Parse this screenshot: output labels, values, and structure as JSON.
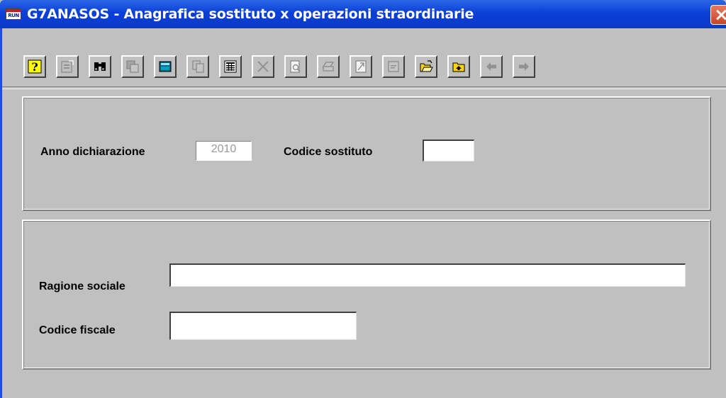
{
  "window": {
    "title": "G7ANASOS - Anagrafica sostituto x operazioni straordinarie",
    "icon_text": "RUN"
  },
  "toolbar": {
    "buttons": [
      {
        "name": "help-button",
        "icon": "question-icon"
      },
      {
        "name": "properties-button",
        "icon": "properties-icon"
      },
      {
        "name": "search-button",
        "icon": "binoculars-icon"
      },
      {
        "name": "copy-record-button",
        "icon": "copy-record-icon"
      },
      {
        "name": "calculator-button",
        "icon": "calculator-icon"
      },
      {
        "name": "paste-button",
        "icon": "paste-icon"
      },
      {
        "name": "list-button",
        "icon": "list-view-icon"
      },
      {
        "name": "delete-button",
        "icon": "delete-x-icon"
      },
      {
        "name": "preview-button",
        "icon": "print-preview-icon"
      },
      {
        "name": "print-button",
        "icon": "printer-icon"
      },
      {
        "name": "export-button",
        "icon": "document-export-icon"
      },
      {
        "name": "note-button",
        "icon": "note-icon"
      },
      {
        "name": "open-folder-button",
        "icon": "open-folder-icon"
      },
      {
        "name": "up-folder-button",
        "icon": "folder-up-icon"
      },
      {
        "name": "previous-button",
        "icon": "arrow-left-icon"
      },
      {
        "name": "next-button",
        "icon": "arrow-right-icon"
      }
    ]
  },
  "header_panel": {
    "anno_label": "Anno dichiarazione",
    "anno_value": "2010",
    "codice_sostituto_label": "Codice sostituto",
    "codice_sostituto_value": ""
  },
  "detail_panel": {
    "ragione_sociale_label": "Ragione sociale",
    "ragione_sociale_value": "",
    "codice_fiscale_label": "Codice fiscale",
    "codice_fiscale_value": ""
  }
}
